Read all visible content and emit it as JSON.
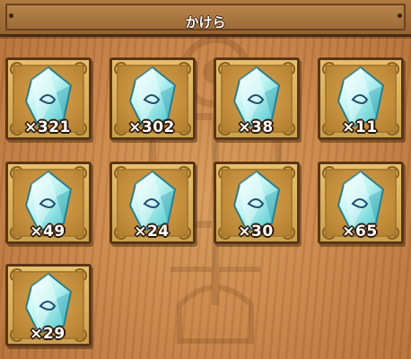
{
  "header": {
    "title": "かけら"
  },
  "items": [
    {
      "icon": "gem-fragment-icon",
      "count": "×321"
    },
    {
      "icon": "gem-fragment-icon",
      "count": "×302"
    },
    {
      "icon": "gem-fragment-icon",
      "count": "×38"
    },
    {
      "icon": "gem-fragment-icon",
      "count": "×11"
    },
    {
      "icon": "gem-fragment-icon",
      "count": "×49"
    },
    {
      "icon": "gem-fragment-icon",
      "count": "×24"
    },
    {
      "icon": "gem-fragment-icon",
      "count": "×30"
    },
    {
      "icon": "gem-fragment-icon",
      "count": "×65"
    },
    {
      "icon": "gem-fragment-icon",
      "count": "×29"
    }
  ],
  "colors": {
    "crystal": "#bff4f2",
    "frame": "#e0b866",
    "border": "#5a3616"
  }
}
